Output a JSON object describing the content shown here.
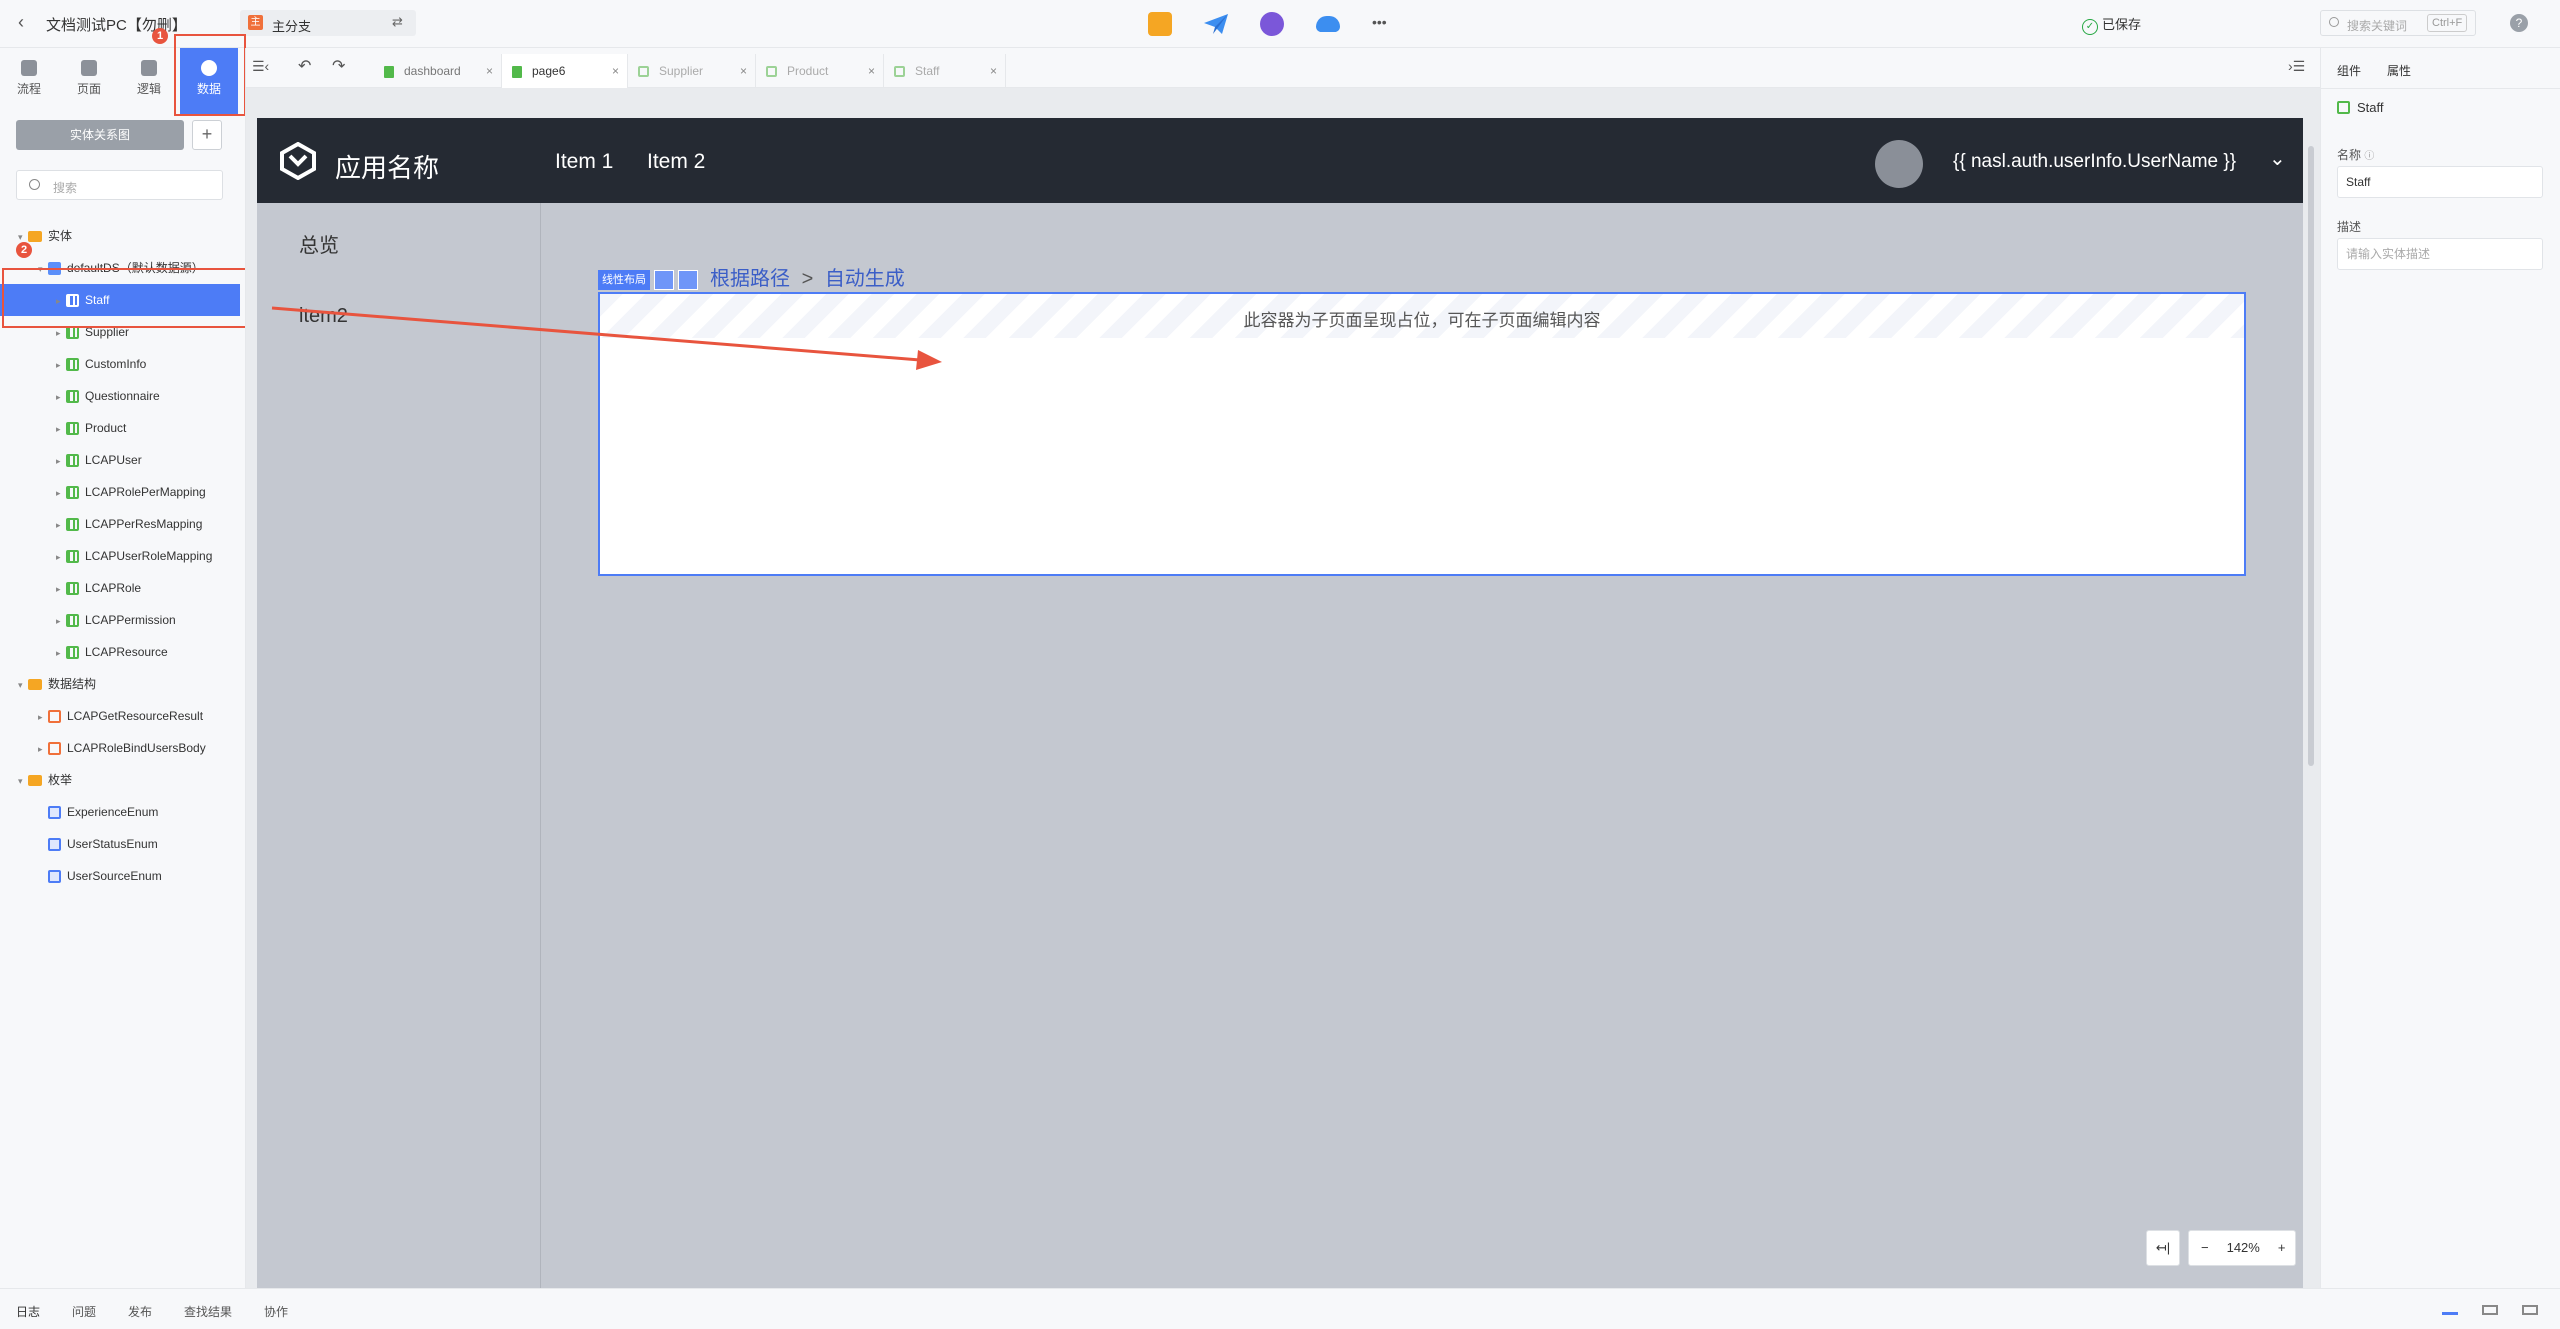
{
  "topbar": {
    "project_title": "文档测试PC【勿删】",
    "branch_name": "主分支",
    "branch_icon_letter": "主",
    "saved_status": "已保存",
    "search_placeholder": "搜索关键词",
    "search_shortcut": "Ctrl+F",
    "more": "•••",
    "help": "?"
  },
  "rail_tabs": [
    {
      "label": "流程",
      "icon": "flow-icon"
    },
    {
      "label": "页面",
      "icon": "page-icon"
    },
    {
      "label": "逻辑",
      "icon": "logic-icon"
    },
    {
      "label": "数据",
      "icon": "data-icon",
      "active": true
    }
  ],
  "annotations": {
    "badge1": "1",
    "badge2": "2"
  },
  "left_panel": {
    "er_button": "实体关系图",
    "add_button": "+",
    "search_placeholder": "搜索"
  },
  "tree": {
    "entities_folder": "实体",
    "datasource": "defaultDS（默认数据源）",
    "entities": [
      "Staff",
      "Supplier",
      "CustomInfo",
      "Questionnaire",
      "Product",
      "LCAPUser",
      "LCAPRolePerMapping",
      "LCAPPerResMapping",
      "LCAPUserRoleMapping",
      "LCAPRole",
      "LCAPPermission",
      "LCAPResource"
    ],
    "structures_folder": "数据结构",
    "structures": [
      "LCAPGetResourceResult",
      "LCAPRoleBindUsersBody"
    ],
    "enums_folder": "枚举",
    "enums": [
      "ExperienceEnum",
      "UserStatusEnum",
      "UserSourceEnum"
    ]
  },
  "editor_tabs": [
    {
      "label": "dashboard",
      "close": "×"
    },
    {
      "label": "page6",
      "close": "×",
      "active": true
    },
    {
      "label": "Supplier",
      "close": "×"
    },
    {
      "label": "Product",
      "close": "×"
    },
    {
      "label": "Staff",
      "close": "×"
    }
  ],
  "app": {
    "name": "应用名称",
    "nav_items": [
      "Item 1",
      "Item 2"
    ],
    "username": "{{ nasl.auth.userInfo.UserName }}",
    "side_items": [
      "总览",
      "item2"
    ],
    "breadcrumb_root": "根据路径",
    "breadcrumb_sep": ">",
    "breadcrumb_leaf": "自动生成",
    "selection_tag": "线性布局",
    "container_placeholder": "此容器为子页面呈现占位，可在子页面编辑内容"
  },
  "zoom": {
    "collapse": "↤|",
    "minus": "−",
    "level": "142%",
    "plus": "+"
  },
  "right_panel": {
    "tabs": [
      "组件",
      "属性"
    ],
    "entity_name": "Staff",
    "name_label": "名称",
    "name_value": "Staff",
    "desc_label": "描述",
    "desc_placeholder": "请输入实体描述"
  },
  "bottom_tabs": [
    "日志",
    "问题",
    "发布",
    "查找结果",
    "协作"
  ],
  "colors": {
    "accent": "#4d7cf6",
    "annotation_red": "#e8543e",
    "app_header": "#252a33",
    "entity_green": "#52b94a"
  }
}
